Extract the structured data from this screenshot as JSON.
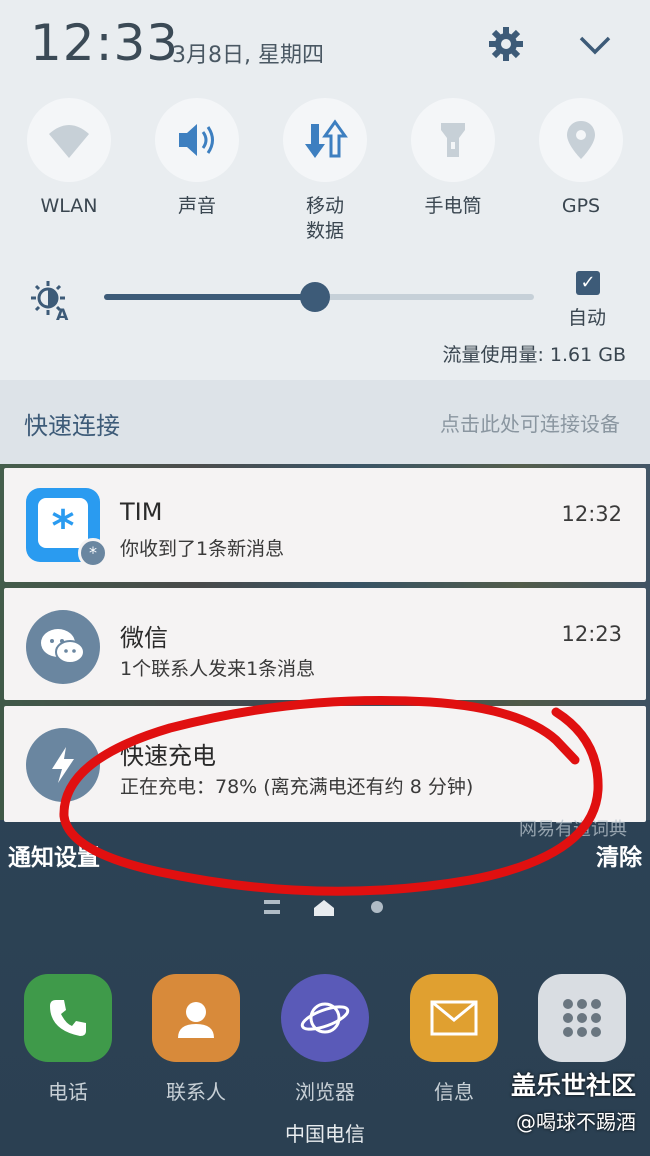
{
  "status": {
    "time": "12:33",
    "date": "3月8日, 星期四"
  },
  "toggles": [
    {
      "label": "WLAN",
      "icon": "wifi-icon"
    },
    {
      "label": "声音",
      "icon": "speaker-icon"
    },
    {
      "label": "移动\n数据",
      "label_line1": "移动",
      "label_line2": "数据",
      "icon": "mobile-data-icon"
    },
    {
      "label": "手电筒",
      "icon": "flashlight-icon"
    },
    {
      "label": "GPS",
      "icon": "location-icon"
    }
  ],
  "brightness": {
    "level": 0.49,
    "auto_label": "自动",
    "auto_checked": true
  },
  "data_usage": "流量使用量: 1.61 GB",
  "quick_connect": {
    "title": "快速连接",
    "hint": "点击此处可连接设备"
  },
  "notifications": [
    {
      "app": "TIM",
      "message": "你收到了1条新消息",
      "time": "12:32"
    },
    {
      "app": "微信",
      "message": "1个联系人发来1条消息",
      "time": "12:23"
    },
    {
      "app": "快速充电",
      "message": "正在充电：78% (离充满电还有约 8 分钟)",
      "time": ""
    }
  ],
  "footer": {
    "settings": "通知设置",
    "clear": "清除",
    "ghost_app": "网易有道词典"
  },
  "dock": [
    {
      "label": "电话",
      "icon": "phone-icon",
      "color": "#3f9a4a"
    },
    {
      "label": "联系人",
      "icon": "contacts-icon",
      "color": "#d88a3a"
    },
    {
      "label": "浏览器",
      "icon": "browser-icon",
      "color": "#5a5ab8"
    },
    {
      "label": "信息",
      "icon": "message-icon",
      "color": "#e0a030"
    },
    {
      "label": "",
      "icon": "apps-grid-icon",
      "color": "#d9dde2"
    }
  ],
  "carrier": "中国电信",
  "watermark": {
    "line1": "盖乐世社区",
    "line2": "@喝球不踢酒"
  },
  "colors": {
    "accent": "#3d5b78",
    "panel": "#e9edf0",
    "annotation": "#e01010"
  }
}
